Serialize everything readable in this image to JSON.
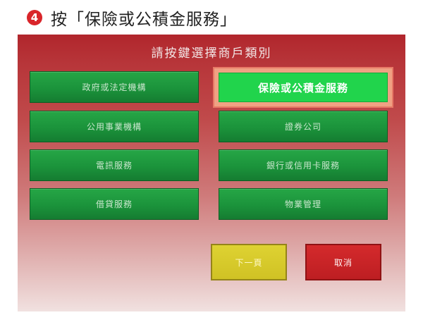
{
  "step": {
    "number": "4",
    "title": "按「保險或公積金服務」"
  },
  "screen": {
    "header": "請按鍵選擇商戶類別",
    "left_buttons": [
      "政府或法定機構",
      "公用事業機構",
      "電訊服務",
      "借貸服務"
    ],
    "right_buttons": [
      "保險或公積金服務",
      "證券公司",
      "銀行或信用卡服務",
      "物業管理"
    ],
    "next_label": "下一頁",
    "cancel_label": "取消",
    "colors": {
      "header_red": "#b1262c",
      "button_green": "#1b933b",
      "selected_green": "#21d44c",
      "highlight_ring": "#f0a183",
      "next_yellow": "#d0c224",
      "cancel_red": "#bd1e22"
    }
  }
}
